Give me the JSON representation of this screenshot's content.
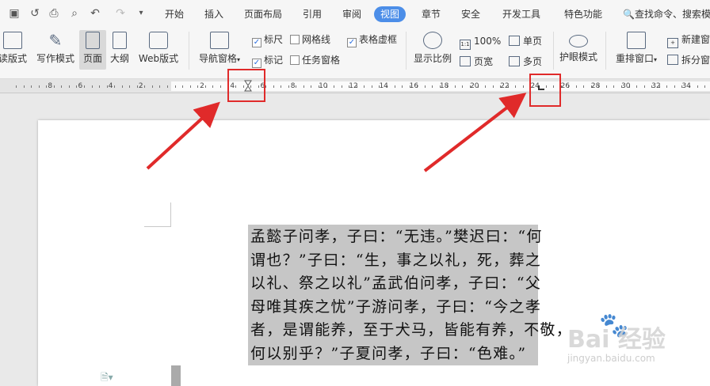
{
  "menubar": {
    "tabs": [
      {
        "label": "开始"
      },
      {
        "label": "插入"
      },
      {
        "label": "页面布局"
      },
      {
        "label": "引用"
      },
      {
        "label": "审阅"
      },
      {
        "label": "视图"
      },
      {
        "label": "章节"
      },
      {
        "label": "安全"
      },
      {
        "label": "开发工具"
      },
      {
        "label": "特色功能"
      }
    ],
    "active_tab": "视图",
    "search_label": "查找命令、搜索模"
  },
  "ribbon": {
    "read_mode": "读版式",
    "write_mode": "写作模式",
    "page_view": "页面",
    "outline": "大纲",
    "web_layout": "Web版式",
    "nav_pane": "导航窗格",
    "ruler": "标尺",
    "gridlines": "网格线",
    "table_gridlines": "表格虚框",
    "markup": "标记",
    "task_pane": "任务窗格",
    "zoom": "显示比例",
    "zoom_100": "100%",
    "page_width": "页宽",
    "single_page": "单页",
    "multi_page": "多页",
    "eye_protection": "护眼模式",
    "rearrange": "重排窗口",
    "new_window": "新建窗",
    "split_window": "拆分窗"
  },
  "ruler": {
    "left_numbers": [
      "8",
      "6",
      "4",
      "2"
    ],
    "right_numbers": [
      "2",
      "4",
      "6",
      "8",
      "10",
      "12",
      "14",
      "16",
      "18",
      "20",
      "22",
      "24",
      "26",
      "28",
      "30",
      "32",
      "34"
    ]
  },
  "document": {
    "lines": [
      "孟懿子问孝，子曰：“无违。”樊迟曰：“何",
      "谓也？”子曰：“生，事之以礼，死，葬之",
      "以礼、祭之以礼”孟武伯问孝，子曰：“父",
      "母唯其疾之忧”子游问孝，子曰：“今之孝",
      "者，是谓能养，至于犬马，皆能有养，不敬，",
      "何以别乎？”子夏问孝，子曰：“色难。”"
    ]
  },
  "watermark": {
    "brand": "Bai 经验",
    "url": "jingyan.baidu.com"
  },
  "colors": {
    "accent": "#4c8ee8",
    "callout": "#e02a2a",
    "selection": "#c6c6c6"
  }
}
